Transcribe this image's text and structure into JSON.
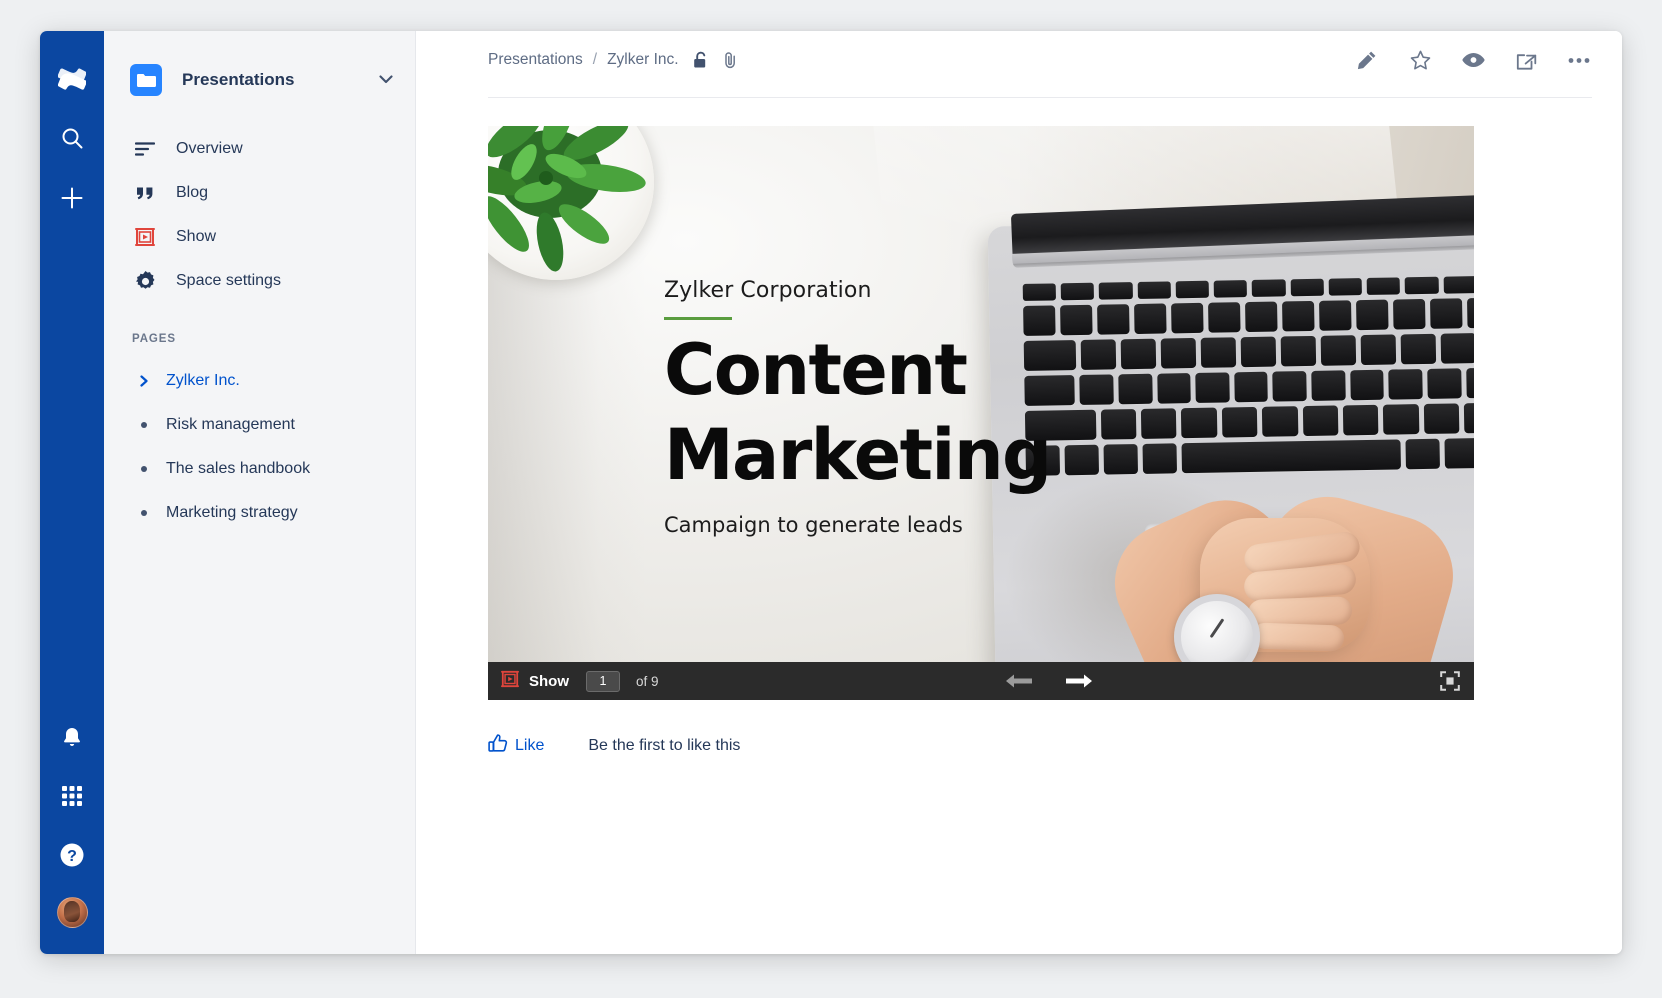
{
  "rail": {
    "logo_icon": "confluence-logo-icon",
    "items": [
      {
        "name": "search",
        "icon": "search-icon"
      },
      {
        "name": "create",
        "icon": "plus-icon"
      }
    ],
    "bottom_items": [
      {
        "name": "notifications",
        "icon": "bell-icon"
      },
      {
        "name": "app-switcher",
        "icon": "grid-icon"
      },
      {
        "name": "help",
        "icon": "question-circle-icon"
      },
      {
        "name": "profile",
        "icon": "avatar"
      }
    ]
  },
  "sidebar": {
    "space_name": "Presentations",
    "space_logo_icon": "folder-icon",
    "collapse_icon": "chevron-down-icon",
    "nav": [
      {
        "label": "Overview",
        "icon": "lines-icon"
      },
      {
        "label": "Blog",
        "icon": "quote-icon"
      },
      {
        "label": "Show",
        "icon": "show-play-icon"
      },
      {
        "label": "Space settings",
        "icon": "gear-icon"
      }
    ],
    "pages_header": "PAGES",
    "pages": [
      {
        "label": "Zylker Inc.",
        "marker": "chevron-right-icon",
        "active": true
      },
      {
        "label": "Risk management",
        "marker": "bullet",
        "active": false
      },
      {
        "label": "The sales handbook",
        "marker": "bullet",
        "active": false
      },
      {
        "label": "Marketing strategy",
        "marker": "bullet",
        "active": false
      }
    ]
  },
  "topbar": {
    "breadcrumb": {
      "root": "Presentations",
      "separator": "/",
      "current": "Zylker Inc.",
      "lock_icon": "unlocked-padlock-icon",
      "attachment_icon": "paperclip-icon"
    },
    "actions": [
      {
        "name": "edit",
        "icon": "pencil-icon"
      },
      {
        "name": "favorite",
        "icon": "star-outline-icon"
      },
      {
        "name": "watch",
        "icon": "eye-icon"
      },
      {
        "name": "share",
        "icon": "share-icon"
      },
      {
        "name": "more",
        "icon": "ellipsis-icon"
      }
    ]
  },
  "slide": {
    "organization": "Zylker Corporation",
    "title_line_1": "Content",
    "title_line_2": "Marketing",
    "subtitle": "Campaign to generate leads",
    "accent_color": "#5a9d3f"
  },
  "player": {
    "brand_label": "Show",
    "brand_icon": "show-play-icon",
    "current_page": "1",
    "of_label": "of 9",
    "prev_icon": "arrow-left-icon",
    "next_icon": "arrow-right-icon",
    "fullscreen_icon": "fullscreen-icon"
  },
  "footer": {
    "like_label": "Like",
    "like_icon": "thumbs-up-icon",
    "like_status": "Be the first to like this"
  },
  "colors": {
    "rail_blue": "#0B47A1",
    "space_logo_blue": "#2684FF",
    "link_blue": "#0052CC",
    "sidebar_bg": "#f4f5f7",
    "player_bg": "#2b2b2b",
    "show_red": "#e0453c"
  }
}
